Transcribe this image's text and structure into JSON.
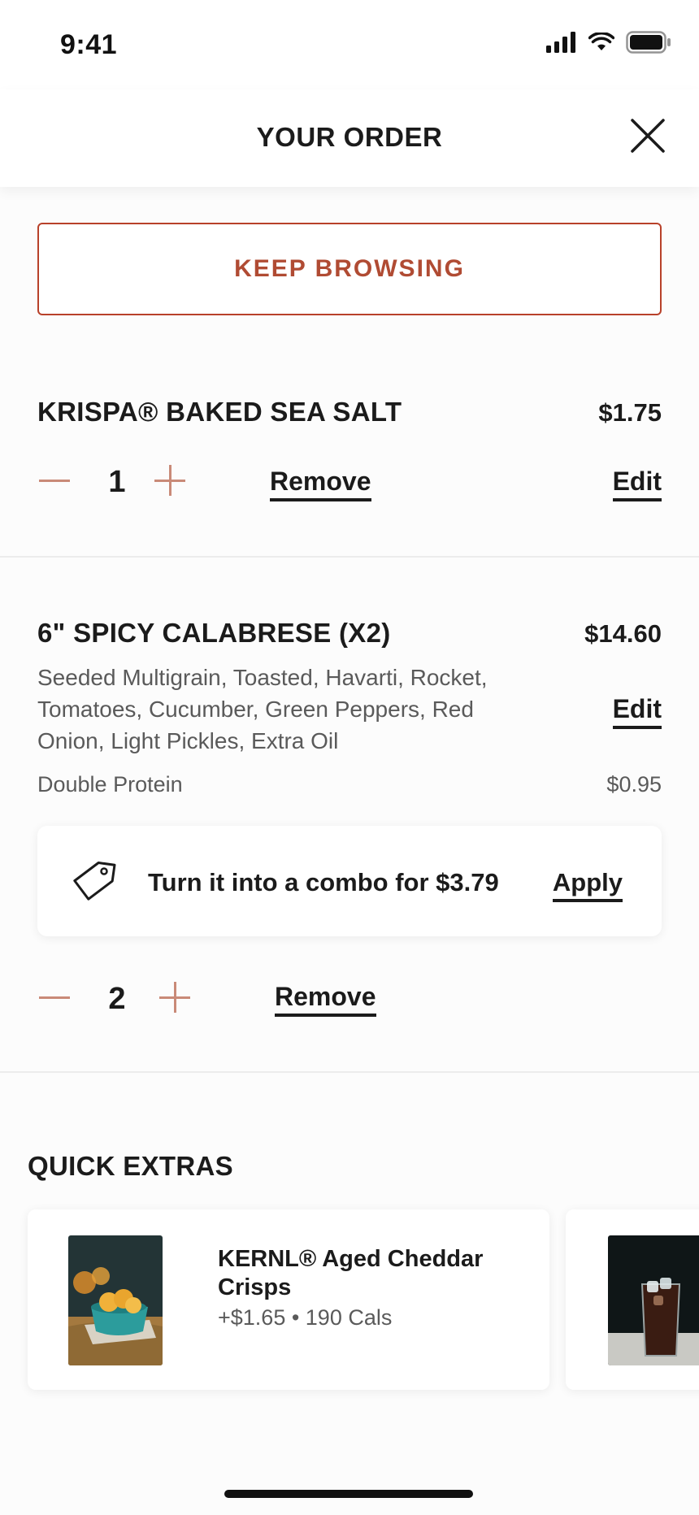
{
  "status_bar": {
    "time": "9:41"
  },
  "header": {
    "title": "YOUR ORDER"
  },
  "keep_browsing": {
    "label": "KEEP BROWSING"
  },
  "items": [
    {
      "title": "KRISPA® BAKED SEA SALT",
      "price": "$1.75",
      "quantity": "1",
      "remove_label": "Remove",
      "edit_label": "Edit"
    },
    {
      "title": "6\" SPICY CALABRESE (X2)",
      "price": "$14.60",
      "description": "Seeded Multigrain, Toasted, Havarti, Rocket, Tomatoes, Cucumber, Green Peppers, Red Onion, Light Pickles, Extra Oil",
      "edit_label": "Edit",
      "addon_label": "Double Protein",
      "addon_price": "$0.95",
      "combo_text": "Turn it into a combo for $3.79",
      "combo_apply_label": "Apply",
      "quantity": "2",
      "remove_label": "Remove"
    }
  ],
  "quick_extras": {
    "title": "QUICK EXTRAS",
    "items": [
      {
        "name": "KERNL® Aged Cheddar Crisps",
        "meta": "+$1.65 • 190 Cals",
        "image": "cheddar-crisps-bowl"
      },
      {
        "name": "",
        "meta": "",
        "image": "iced-cola-glass"
      }
    ]
  }
}
